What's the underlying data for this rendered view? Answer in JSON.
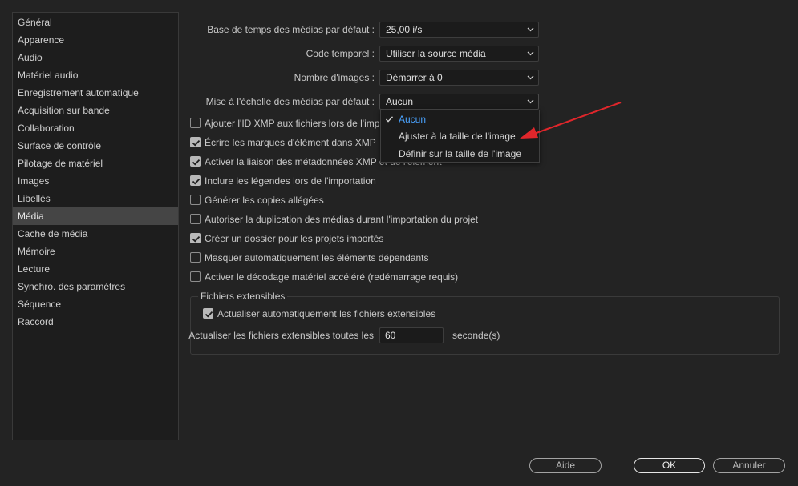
{
  "sidebar": {
    "items": [
      {
        "label": "Général"
      },
      {
        "label": "Apparence"
      },
      {
        "label": "Audio"
      },
      {
        "label": "Matériel audio"
      },
      {
        "label": "Enregistrement automatique"
      },
      {
        "label": "Acquisition sur bande"
      },
      {
        "label": "Collaboration"
      },
      {
        "label": "Surface de contrôle"
      },
      {
        "label": "Pilotage de matériel"
      },
      {
        "label": "Images"
      },
      {
        "label": "Libellés"
      },
      {
        "label": "Média"
      },
      {
        "label": "Cache de média"
      },
      {
        "label": "Mémoire"
      },
      {
        "label": "Lecture"
      },
      {
        "label": "Synchro. des paramètres"
      },
      {
        "label": "Séquence"
      },
      {
        "label": "Raccord"
      }
    ],
    "selected": "Média"
  },
  "settings": {
    "timebase": {
      "label": "Base de temps des médias par défaut :",
      "value": "25,00  i/s"
    },
    "timecode": {
      "label": "Code temporel :",
      "value": "Utiliser la source média"
    },
    "frame_count": {
      "label": "Nombre d'images :",
      "value": "Démarrer à 0"
    },
    "scaling": {
      "label": "Mise à l'échelle des médias par défaut :",
      "value": "Aucun"
    }
  },
  "scaling_menu": {
    "options": [
      {
        "label": "Aucun",
        "selected": true
      },
      {
        "label": "Ajuster à la taille de l'image",
        "selected": false
      },
      {
        "label": "Définir sur la taille de l'image",
        "selected": false
      }
    ]
  },
  "checkboxes": [
    {
      "label": "Ajouter l'ID XMP aux fichiers lors de l'importation",
      "checked": false
    },
    {
      "label": "Écrire les marques d'élément dans XMP",
      "checked": true
    },
    {
      "label": "Activer la liaison des métadonnées XMP et de l'élément",
      "checked": true
    },
    {
      "label": "Inclure les légendes lors de l'importation",
      "checked": true
    },
    {
      "label": "Générer les copies allégées",
      "checked": false
    },
    {
      "label": "Autoriser la duplication des médias durant l'importation du projet",
      "checked": false
    },
    {
      "label": "Créer un dossier pour les projets importés",
      "checked": true
    },
    {
      "label": "Masquer automatiquement les éléments dépendants",
      "checked": false
    },
    {
      "label": "Activer le décodage matériel accéléré (redémarrage requis)",
      "checked": false
    }
  ],
  "growing_files": {
    "title": "Fichiers extensibles",
    "auto_refresh": {
      "label": "Actualiser automatiquement les fichiers extensibles",
      "checked": true
    },
    "interval_label": "Actualiser les fichiers extensibles toutes les",
    "interval_value": "60",
    "interval_unit": "seconde(s)"
  },
  "buttons": {
    "help": "Aide",
    "ok": "OK",
    "cancel": "Annuler"
  },
  "colors": {
    "accent": "#4aa3ff",
    "annotation_arrow": "#e0262b"
  }
}
